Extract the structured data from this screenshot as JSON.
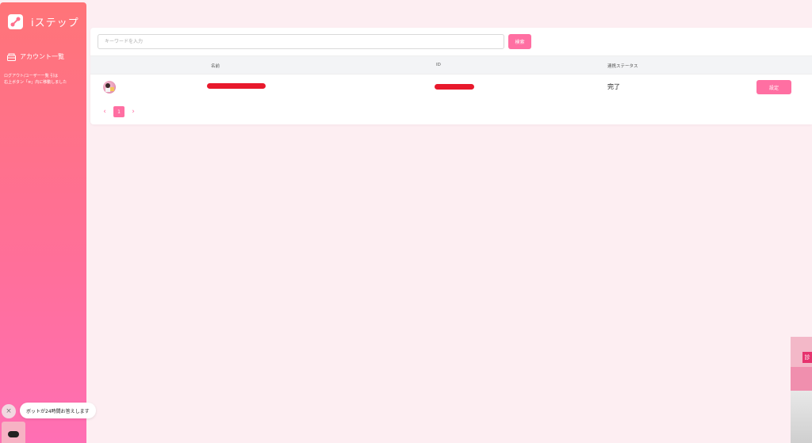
{
  "app": {
    "title": "iステップ"
  },
  "sidebar": {
    "nav_item": "アカウント一覧",
    "notice_line1": "ログアウト/ユーザー一覧 引は",
    "notice_line2": "右上ボタン「≡」内に移動しました"
  },
  "search": {
    "placeholder": "キーワードを入力",
    "button": "検索"
  },
  "table": {
    "headers": [
      "名前",
      "ID",
      "連携ステータス"
    ],
    "rows": [
      {
        "status": "完了",
        "action": "設定"
      }
    ]
  },
  "pagination": {
    "prev": "‹",
    "current": "1",
    "next": "›"
  },
  "chat": {
    "message": "ボットが24時間お答えします",
    "close": "×"
  },
  "ad": {
    "tag": "診"
  },
  "colors": {
    "accent": "#ff6fa2",
    "sidebar_top": "#ff7478",
    "sidebar_bottom": "#ff6fb4",
    "background": "#fdeef2"
  }
}
